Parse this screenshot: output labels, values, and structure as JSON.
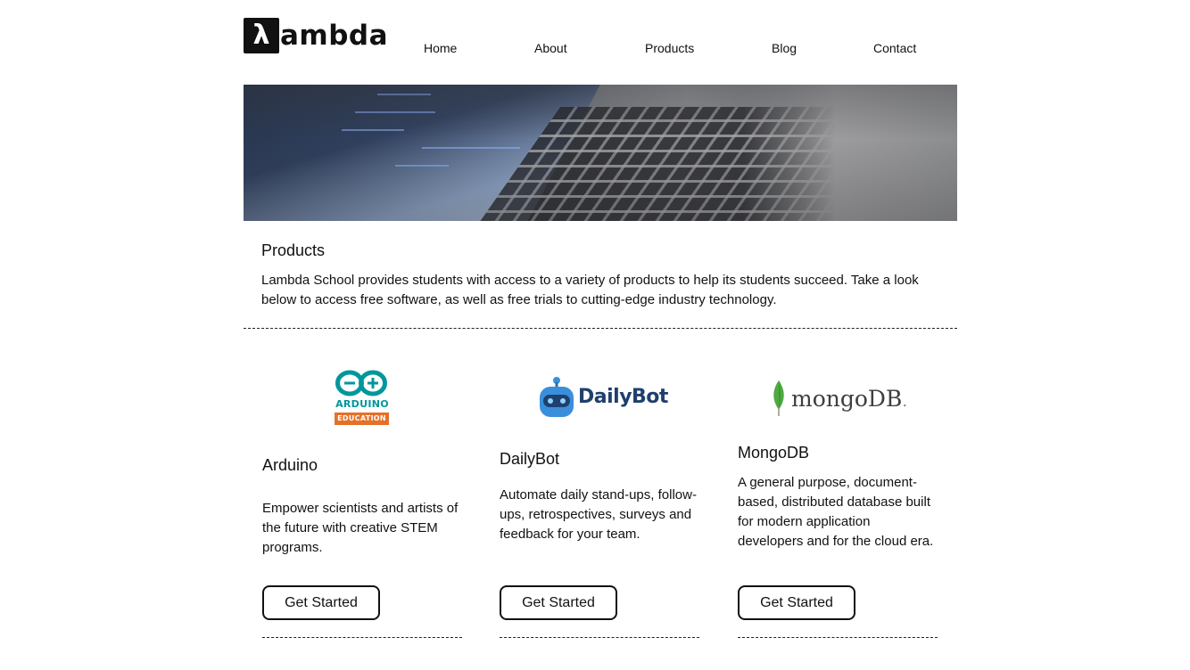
{
  "brand": {
    "mark": "λ",
    "text": "ambda"
  },
  "nav": [
    "Home",
    "About",
    "Products",
    "Blog",
    "Contact"
  ],
  "intro": {
    "title": "Products",
    "body": "Lambda School provides students with access to a variety of products to help its students succeed. Take a look below to access free software, as well as free trials to cutting-edge industry technology."
  },
  "products": [
    {
      "logo": {
        "top": "ARDUINO",
        "bottom": "EDUCATION"
      },
      "name": "Arduino",
      "description": "Empower scientists and artists of the future with creative STEM programs.",
      "cta": "Get Started"
    },
    {
      "logo": {
        "text": "DailyBot"
      },
      "name": "DailyBot",
      "description": "Automate daily stand-ups, follow-ups, retrospectives, surveys and feedback for your team.",
      "cta": "Get Started"
    },
    {
      "logo": {
        "text": "mongoDB",
        "mark": "."
      },
      "name": "MongoDB",
      "description": "A general purpose, document-based, distributed database built for modern application developers and for the cloud era.",
      "cta": "Get Started"
    }
  ],
  "colors": {
    "arduino_teal": "#00979c",
    "arduino_orange": "#e47128",
    "dailybot_blue": "#3a8fdc",
    "mongo_green": "#4faa41",
    "mongo_text": "#3f3f3f"
  }
}
